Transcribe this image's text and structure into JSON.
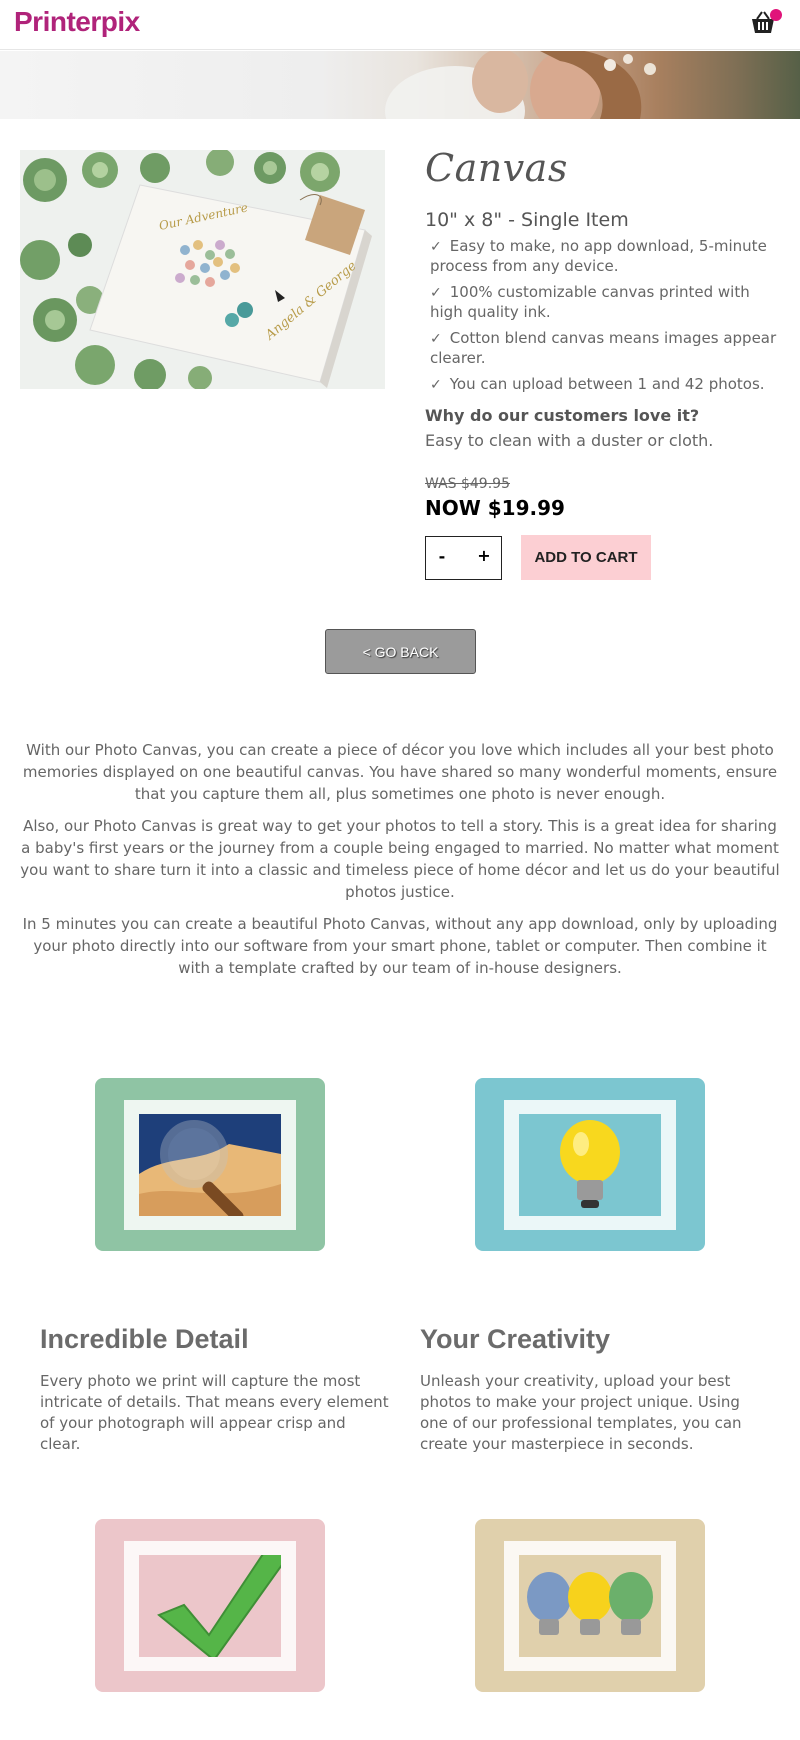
{
  "header": {
    "logo": "Printerpix",
    "cart_icon": "basket-icon",
    "cart_badge_color": "#e0147a"
  },
  "product": {
    "title": "Canvas",
    "variant": "10\" x 8\" - Single Item",
    "features": [
      "Easy to make, no app download, 5-minute process from any device.",
      "100% customizable canvas printed with high quality ink.",
      "Cotton blend canvas means images appear clearer.",
      "You can upload between 1 and 42 photos."
    ],
    "check_glyph": "✓",
    "love_heading": "Why do our customers love it?",
    "love_text": "Easy to clean with a duster or cloth.",
    "was_price": "WAS $49.95",
    "now_price": "NOW $19.99",
    "qty_minus": "-",
    "qty_plus": "+",
    "add_to_cart": "ADD TO CART",
    "add_to_cart_color": "#fccfd3"
  },
  "go_back": "< GO BACK",
  "description": [
    "With our Photo Canvas, you can create a piece of décor you love which includes all your best photo memories displayed on one beautiful canvas. You have shared so many wonderful moments, ensure that you capture them all, plus sometimes one photo is never enough.",
    "Also, our Photo Canvas is great way to get your photos to tell a story. This is a great idea for sharing a baby's first years or the journey from a couple being engaged to married. No matter what moment you want to share turn it into a classic and timeless piece of home décor and let us do your beautiful photos justice.",
    "In 5 minutes you can create a beautiful Photo Canvas, without any app download, only by uploading your photo directly into our software from your smart phone, tablet or computer. Then combine it with a template crafted by our team of in-house designers."
  ],
  "features_grid": [
    {
      "title": "Incredible Detail",
      "text": "Every photo we print will capture the most intricate of details. That means every element of your photograph will appear crisp and clear.",
      "icon": "magnifier-icon",
      "tile_color": "#8fc4a4"
    },
    {
      "title": "Your Creativity",
      "text": "Unleash your creativity, upload your best photos to make your project unique. Using one of our professional templates, you can create your masterpiece in seconds.",
      "icon": "lightbulb-icon",
      "tile_color": "#7cc6d0"
    },
    {
      "icon": "checkmark-icon",
      "tile_color": "#ecc6ca"
    },
    {
      "icon": "three-lightbulbs-icon",
      "tile_color": "#e0d0ac"
    }
  ]
}
